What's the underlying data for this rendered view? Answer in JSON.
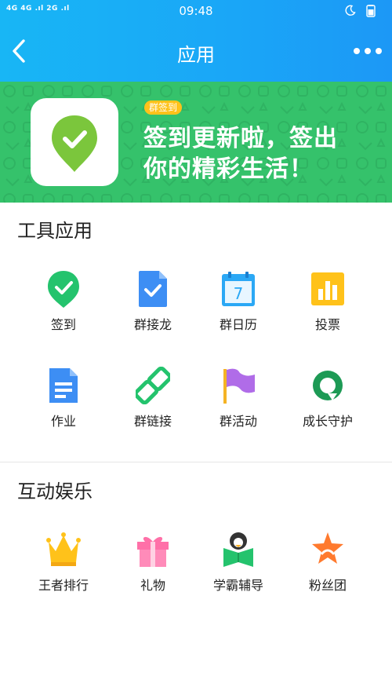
{
  "status_bar": {
    "signal_text": "4G 4G .ıl 2G .ıl",
    "time": "09:48"
  },
  "header": {
    "title": "应用",
    "back_icon": "chevron-left-icon",
    "more_icon": "more-dots-icon"
  },
  "banner": {
    "tag": "群签到",
    "line1": "签到更新啦，签出",
    "line2": "你的精彩生活！",
    "icon": "checkin-pin-icon"
  },
  "sections": [
    {
      "title": "工具应用",
      "apps": [
        {
          "label": "签到",
          "icon": "checkin-icon"
        },
        {
          "label": "群接龙",
          "icon": "relay-doc-icon"
        },
        {
          "label": "群日历",
          "icon": "calendar-icon"
        },
        {
          "label": "投票",
          "icon": "vote-icon"
        },
        {
          "label": "作业",
          "icon": "homework-icon"
        },
        {
          "label": "群链接",
          "icon": "link-icon"
        },
        {
          "label": "群活动",
          "icon": "flag-icon"
        },
        {
          "label": "成长守护",
          "icon": "guard-icon"
        }
      ]
    },
    {
      "title": "互动娱乐",
      "apps": [
        {
          "label": "王者排行",
          "icon": "crown-icon"
        },
        {
          "label": "礼物",
          "icon": "gift-icon"
        },
        {
          "label": "学霸辅导",
          "icon": "tutor-book-icon"
        },
        {
          "label": "粉丝团",
          "icon": "fan-star-icon"
        }
      ]
    }
  ],
  "calendar_day": "7",
  "colors": {
    "header": "#1aa6f7",
    "banner": "#35c26b",
    "tag": "#ffc21a"
  }
}
